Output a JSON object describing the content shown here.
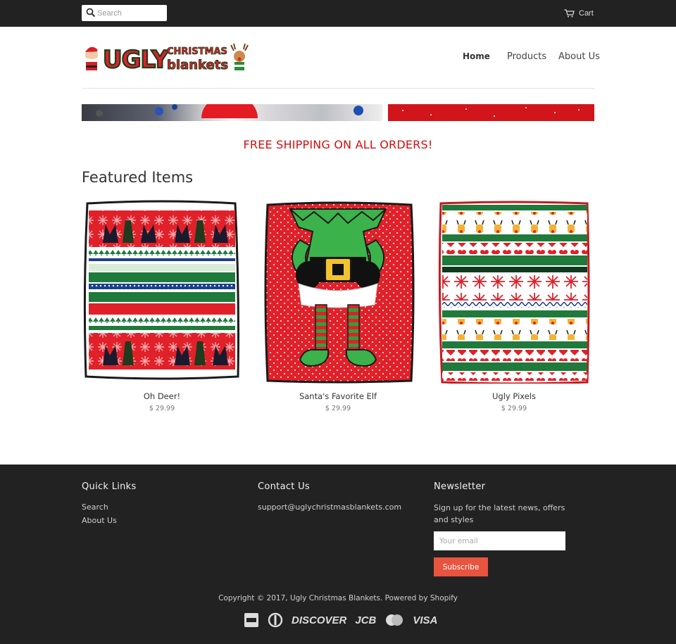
{
  "topbar": {
    "search_placeholder": "Search",
    "cart_label": "Cart"
  },
  "header": {
    "logo_text_1": "UGLY",
    "logo_text_2": "CHRISTMAS",
    "logo_text_3": "blankets",
    "nav": [
      "Home",
      "Products",
      "About Us"
    ]
  },
  "banner": {
    "shipping_text": "FREE SHIPPING ON ALL ORDERS!"
  },
  "featured": {
    "title": "Featured Items",
    "products": [
      {
        "name": "Oh Deer!",
        "price": "$ 29.99"
      },
      {
        "name": "Santa's Favorite Elf",
        "price": "$ 29.99"
      },
      {
        "name": "Ugly Pixels",
        "price": "$ 29.99"
      }
    ]
  },
  "footer": {
    "quick_links": {
      "title": "Quick Links",
      "items": [
        "Search",
        "About Us"
      ]
    },
    "contact": {
      "title": "Contact Us",
      "email": "support@uglychristmasblankets.com"
    },
    "newsletter": {
      "title": "Newsletter",
      "text": "Sign up for the latest news, offers and styles",
      "email_placeholder": "Your email",
      "button_label": "Subscribe"
    },
    "copyright": "Copyright © 2017, Ugly Christmas Blankets. Powered by Shopify",
    "payment_icons": [
      "american-express-icon",
      "diners-club-icon",
      "discover-icon",
      "jcb-icon",
      "mastercard-icon",
      "visa-icon"
    ],
    "payment_labels": {
      "discover": "DISCOVER",
      "jcb": "JCB",
      "visa": "VISA"
    }
  },
  "colors": {
    "topbar_bg": "#222222",
    "accent_red": "#d20f0f",
    "subscribe_bg": "#e7543f"
  }
}
